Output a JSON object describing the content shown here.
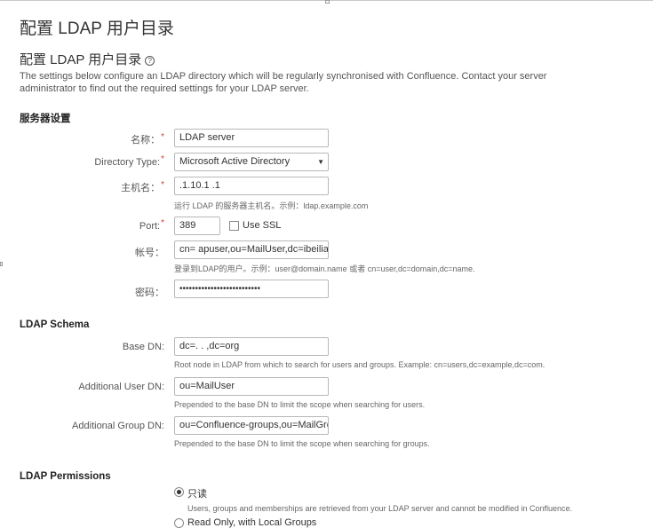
{
  "page_title": "配置 LDAP 用户目录",
  "section_title": "配置 LDAP 用户目录",
  "intro_text": "The settings below configure an LDAP directory which will be regularly synchronised with Confluence. Contact your server administrator to find out the required settings for your LDAP server.",
  "server_settings": {
    "heading": "服务器设置",
    "name": {
      "label": "名称：",
      "value": "LDAP server"
    },
    "directory_type": {
      "label": "Directory Type:",
      "value": "Microsoft Active Directory"
    },
    "hostname": {
      "label": "主机名：",
      "value": "  .1.10.1  .1  ",
      "hint": "运行 LDAP 的服务器主机名。示例：ldap.example.com"
    },
    "port": {
      "label": "Port:",
      "value": "389"
    },
    "use_ssl": {
      "label": "Use SSL",
      "checked": false
    },
    "username": {
      "label": "帐号：",
      "value": "cn=  apuser,ou=MailUser,dc=ibeiliao,c",
      "hint": "登录到LDAP的用户。示例：user@domain.name 或者 cn=user,dc=domain,dc=name."
    },
    "password": {
      "label": "密码：",
      "value": "••••••••••••••••••••••••••"
    }
  },
  "ldap_schema": {
    "heading": "LDAP Schema",
    "base_dn": {
      "label": "Base DN:",
      "value": "dc=.  .  ,dc=org",
      "hint": "Root node in LDAP from which to search for users and groups. Example: cn=users,dc=example,dc=com."
    },
    "additional_user_dn": {
      "label": "Additional User DN:",
      "value": "ou=MailUser",
      "hint": "Prepended to the base DN to limit the scope when searching for users."
    },
    "additional_group_dn": {
      "label": "Additional Group DN:",
      "value": "ou=Confluence-groups,ou=MailGroup",
      "hint": "Prepended to the base DN to limit the scope when searching for groups."
    }
  },
  "ldap_permissions": {
    "heading": "LDAP Permissions",
    "options": [
      {
        "label": "只读",
        "selected": true,
        "description": "Users, groups and memberships are retrieved from your LDAP server and cannot be modified in Confluence."
      },
      {
        "label": "Read Only, with Local Groups",
        "selected": false
      }
    ]
  },
  "colors": {
    "required": "#d04437",
    "text": "#333333",
    "hint": "#666666",
    "border": "#b8b8b8"
  }
}
